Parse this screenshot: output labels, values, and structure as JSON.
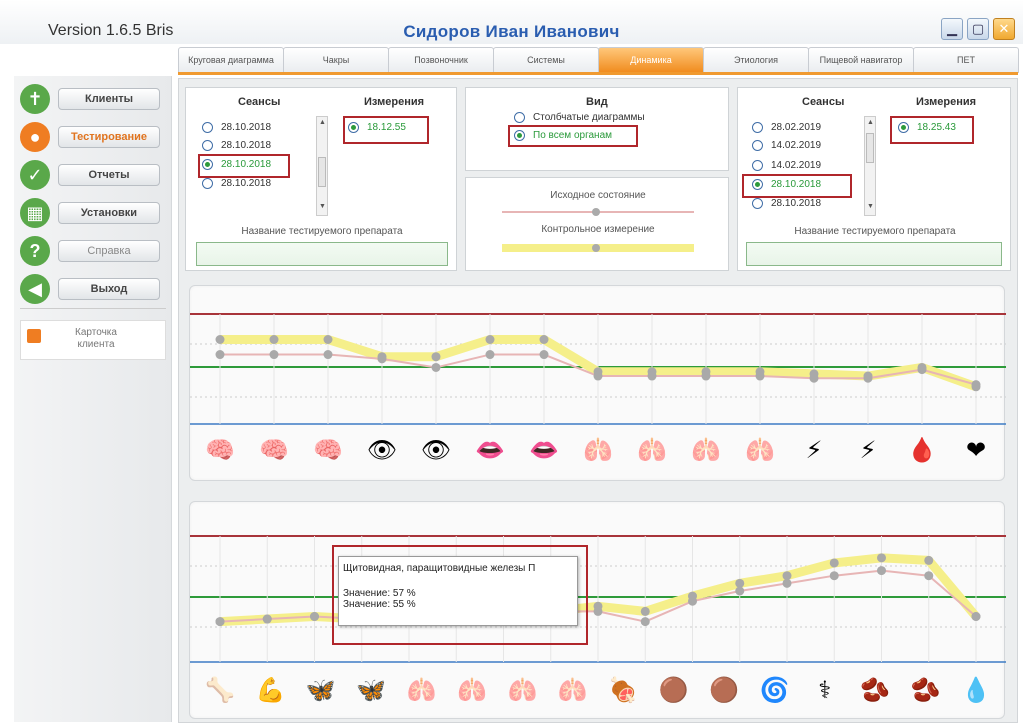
{
  "app": {
    "version": "Version 1.6.5 Bris",
    "patient": "Сидоров Иван Иванович",
    "window_buttons": [
      "minimize-icon",
      "maximize-icon",
      "close-icon"
    ]
  },
  "tabs": [
    {
      "label": "Круговая диаграмма",
      "active": false
    },
    {
      "label": "Чакры",
      "active": false
    },
    {
      "label": "Позвоночник",
      "active": false
    },
    {
      "label": "Системы",
      "active": false
    },
    {
      "label": "Динамика",
      "active": true
    },
    {
      "label": "Этиология",
      "active": false
    },
    {
      "label": "Пищевой навигатор",
      "active": false
    },
    {
      "label": "ПЕТ",
      "active": false
    }
  ],
  "sidebar": {
    "items": [
      {
        "label": "Клиенты",
        "icon": "person-icon",
        "color": "#5aa84a"
      },
      {
        "label": "Тестирование",
        "icon": "user-orange-icon",
        "color": "#ef7d22"
      },
      {
        "label": "Отчеты",
        "icon": "checkmark-icon",
        "color": "#5aa84a"
      },
      {
        "label": "Установки",
        "icon": "grid-icon",
        "color": "#5aa84a"
      },
      {
        "label": "Справка",
        "icon": "question-icon",
        "color": "#5aa84a"
      },
      {
        "label": "Выход",
        "icon": "arrow-left-icon",
        "color": "#5aa84a"
      }
    ],
    "card": "Карточка клиента"
  },
  "left_panel": {
    "sessions_header": "Сеансы",
    "measurements_header": "Измерения",
    "sessions": [
      "28.10.2018",
      "28.10.2018",
      "28.10.2018",
      "28.10.2018"
    ],
    "selected_session_index": 2,
    "measurements": [
      "18.12.55"
    ],
    "drug_label": "Название тестируемого препарата"
  },
  "center_panel": {
    "view_header": "Вид",
    "options": [
      "Столбчатые диаграммы",
      "По всем органам"
    ],
    "selected_option_index": 1,
    "initial_label": "Исходное состояние",
    "control_label": "Контрольное измерение"
  },
  "right_panel": {
    "sessions_header": "Сеансы",
    "measurements_header": "Измерения",
    "sessions": [
      "28.02.2019",
      "14.02.2019",
      "14.02.2019",
      "28.10.2018",
      "28.10.2018"
    ],
    "selected_session_index": 3,
    "measurements": [
      "18.25.43"
    ],
    "drug_label": "Название тестируемого препарата"
  },
  "chart_data": [
    {
      "type": "line",
      "series": [
        {
          "values": [
            70,
            70,
            70,
            62,
            62,
            70,
            70,
            55,
            55,
            55,
            55,
            54,
            53,
            57,
            48
          ]
        },
        {
          "values": [
            63,
            63,
            63,
            61,
            57,
            63,
            63,
            53,
            53,
            53,
            53,
            52,
            52,
            56,
            49
          ]
        }
      ],
      "colors": {
        "series1": "#f5ef8a",
        "series2": "#e7b5b5",
        "upper": "#a8343a",
        "middle": "#2e9b3a",
        "lower": "#3c7bc4"
      },
      "organs": [
        "brain-icon",
        "brain-icon",
        "brain-icon",
        "eye-icon",
        "eye-icon",
        "mouth-icon",
        "mouth-icon",
        "sinus-icon",
        "sinus-icon",
        "throat-icon",
        "throat-icon",
        "nerve-icon",
        "nerve-icon",
        "vessel-icon",
        "heart-icon"
      ]
    },
    {
      "type": "line",
      "series": [
        {
          "values": [
            48,
            49,
            50,
            49,
            49,
            50,
            50,
            52,
            54,
            52,
            58,
            63,
            66,
            71,
            73,
            72,
            50
          ]
        },
        {
          "values": [
            48,
            49,
            50,
            49,
            49,
            50,
            50,
            52,
            52,
            48,
            56,
            60,
            63,
            66,
            68,
            66,
            50
          ]
        }
      ],
      "colors": {
        "series1": "#f5ef8a",
        "series2": "#e7b5b5",
        "upper": "#a8343a",
        "middle": "#2e9b3a",
        "lower": "#3c7bc4"
      },
      "organs": [
        "spine-icon",
        "muscle-icon",
        "thyroid-icon",
        "thyroid-icon",
        "lung-icon",
        "lung-icon",
        "lung-icon",
        "lung-icon",
        "stomach-icon",
        "liver-icon",
        "liver-icon",
        "intestine-icon",
        "uterus-icon",
        "kidney-icon",
        "kidney-icon",
        "bladder-icon"
      ]
    }
  ],
  "tooltip": {
    "title": "Щитовидная, паращитовидные железы П",
    "value1": "Значение: 57 %",
    "value2": "Значение: 55 %"
  }
}
